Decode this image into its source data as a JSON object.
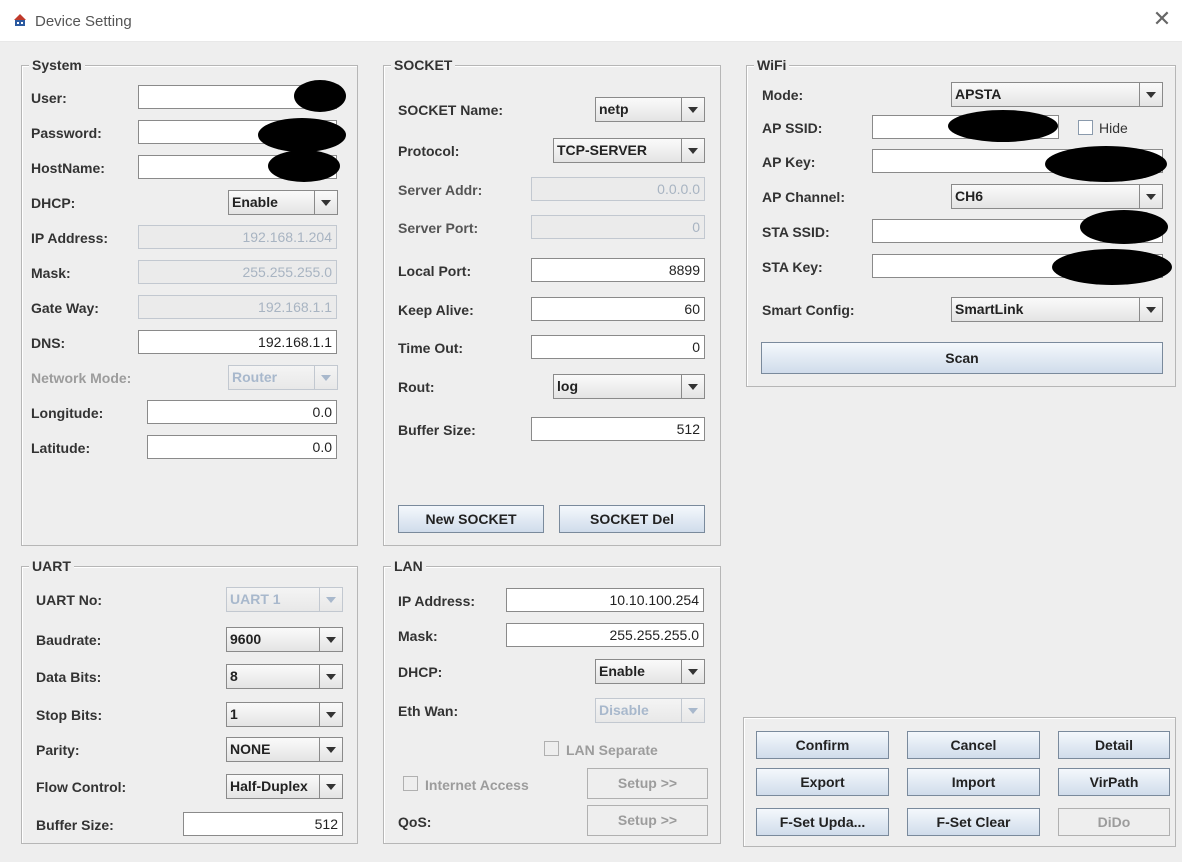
{
  "window": {
    "title": "Device Setting",
    "close_glyph": "✕"
  },
  "system": {
    "title": "System",
    "user_label": "User:",
    "user_value": "",
    "password_label": "Password:",
    "password_value": "",
    "hostname_label": "HostName:",
    "hostname_value": "",
    "dhcp_label": "DHCP:",
    "dhcp_value": "Enable",
    "ip_label": "IP Address:",
    "ip_value": "192.168.1.204",
    "mask_label": "Mask:",
    "mask_value": "255.255.255.0",
    "gateway_label": "Gate Way:",
    "gateway_value": "192.168.1.1",
    "dns_label": "DNS:",
    "dns_value": "192.168.1.1",
    "netmode_label": "Network Mode:",
    "netmode_value": "Router",
    "longitude_label": "Longitude:",
    "longitude_value": "0.0",
    "latitude_label": "Latitude:",
    "latitude_value": "0.0"
  },
  "socket": {
    "title": "SOCKET",
    "name_label": "SOCKET Name:",
    "name_value": "netp",
    "protocol_label": "Protocol:",
    "protocol_value": "TCP-SERVER",
    "server_addr_label": "Server Addr:",
    "server_addr_value": "0.0.0.0",
    "server_port_label": "Server Port:",
    "server_port_value": "0",
    "local_port_label": "Local Port:",
    "local_port_value": "8899",
    "keep_alive_label": "Keep Alive:",
    "keep_alive_value": "60",
    "timeout_label": "Time Out:",
    "timeout_value": "0",
    "rout_label": "Rout:",
    "rout_value": "log",
    "buffer_label": "Buffer Size:",
    "buffer_value": "512",
    "new_button": "New SOCKET",
    "del_button": "SOCKET Del"
  },
  "wifi": {
    "title": "WiFi",
    "mode_label": "Mode:",
    "mode_value": "APSTA",
    "ap_ssid_label": "AP SSID:",
    "ap_ssid_value": "",
    "hide_label": "Hide",
    "ap_key_label": "AP Key:",
    "ap_key_value": "",
    "ap_channel_label": "AP Channel:",
    "ap_channel_value": "CH6",
    "sta_ssid_label": "STA SSID:",
    "sta_ssid_value": "",
    "sta_key_label": "STA Key:",
    "sta_key_value": "",
    "smart_config_label": "Smart Config:",
    "smart_config_value": "SmartLink",
    "scan_button": "Scan"
  },
  "uart": {
    "title": "UART",
    "no_label": "UART No:",
    "no_value": "UART 1",
    "baud_label": "Baudrate:",
    "baud_value": "9600",
    "databits_label": "Data Bits:",
    "databits_value": "8",
    "stopbits_label": "Stop Bits:",
    "stopbits_value": "1",
    "parity_label": "Parity:",
    "parity_value": "NONE",
    "flow_label": "Flow Control:",
    "flow_value": "Half-Duplex",
    "buffer_label": "Buffer Size:",
    "buffer_value": "512"
  },
  "lan": {
    "title": "LAN",
    "ip_label": "IP Address:",
    "ip_value": "10.10.100.254",
    "mask_label": "Mask:",
    "mask_value": "255.255.255.0",
    "dhcp_label": "DHCP:",
    "dhcp_value": "Enable",
    "ethwan_label": "Eth Wan:",
    "ethwan_value": "Disable",
    "separate_label": "LAN Separate",
    "internet_label": "Internet Access",
    "setup_button": "Setup >>",
    "qos_label": "QoS:",
    "qos_button": "Setup >>"
  },
  "actions": {
    "confirm": "Confirm",
    "cancel": "Cancel",
    "detail": "Detail",
    "export": "Export",
    "import": "Import",
    "virpath": "VirPath",
    "fset_update": "F-Set Upda...",
    "fset_clear": "F-Set Clear",
    "dido": "DiDo"
  }
}
